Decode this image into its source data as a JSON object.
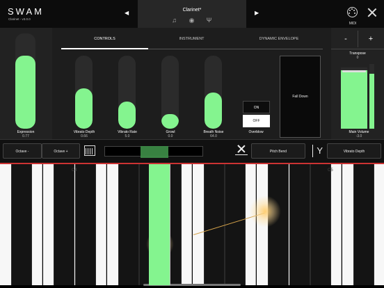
{
  "header": {
    "brand": "SWAM",
    "version": "Clarinet - v3.0.0",
    "preset_name": "Clarinet*",
    "prev_icon": "prev-arrow-icon",
    "next_icon": "next-arrow-icon",
    "midi_label": "MIDI",
    "preset_icons": [
      "music-note-icon",
      "settings-dial-icon",
      "microphone-icon"
    ]
  },
  "tabs": [
    "CONTROLS",
    "INSTRUMENT",
    "DYNAMIC ENVELOPE"
  ],
  "active_tab": "CONTROLS",
  "controls": {
    "expression": {
      "label": "Expression",
      "value": "0.77",
      "level": 0.77
    },
    "vibrato_depth": {
      "label": "Vibrato Depth",
      "value": "0.66",
      "level": 0.55
    },
    "vibrato_rate": {
      "label": "Vibrato Rate",
      "value": "5.0",
      "level": 0.37
    },
    "growl": {
      "label": "Growl",
      "value": "0.0",
      "level": 0.2
    },
    "breath_noise": {
      "label": "Breath Noise",
      "value": "64.0",
      "level": 0.5
    },
    "overblow": {
      "label": "Overblow",
      "on_label": "ON",
      "off_label": "OFF",
      "selected": "OFF"
    },
    "fall_down": {
      "label": "Fall Down"
    }
  },
  "right_panel": {
    "minus_label": "-",
    "plus_label": "+",
    "transpose_label": "Transpose",
    "transpose_value": "0",
    "main_volume_label": "Main Volume",
    "main_volume_value": "-3.0",
    "main_volume_level": 0.95,
    "meter_level": 0.85
  },
  "toolbar": {
    "octave_down": "Octave -",
    "octave_up": "Octave +",
    "pitch_bend": "Pitch Bend",
    "vibrato_depth": "Vibrato Depth"
  },
  "keyboard": {
    "labels": [
      "C4",
      "C5"
    ],
    "active_key": "G4"
  },
  "colors": {
    "accent": "#84f48f",
    "red_line": "#cc3333"
  }
}
